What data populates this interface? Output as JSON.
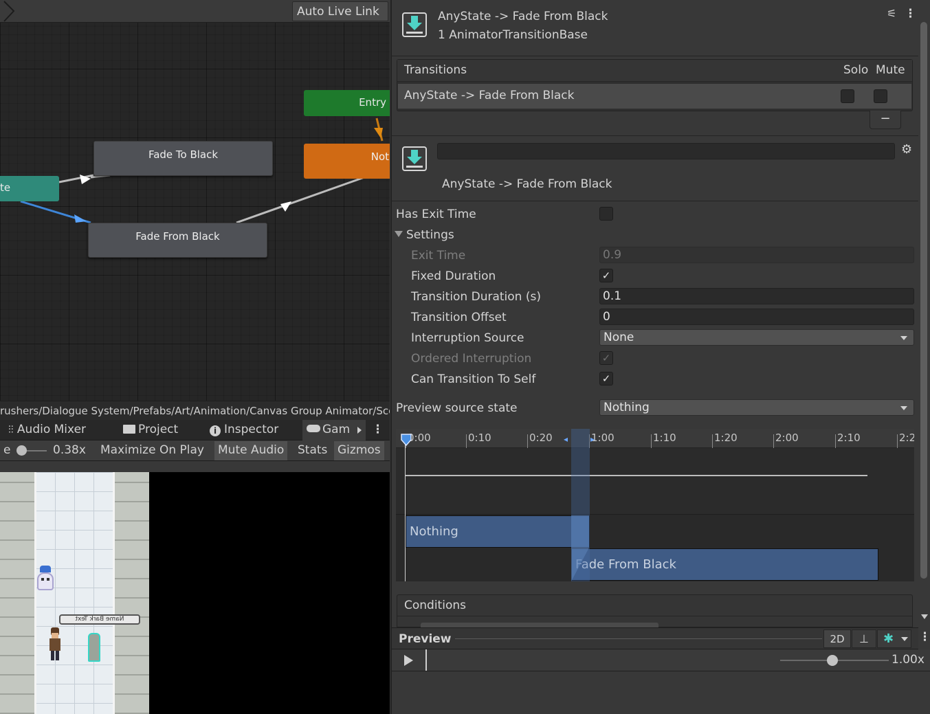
{
  "animator": {
    "auto_live_link": "Auto Live Link",
    "states": {
      "entry": "Entry",
      "not": "Not",
      "fade_to_black": "Fade To Black",
      "fade_from_black": "Fade From Black",
      "any_state_fragment": "te"
    },
    "path": "rushers/Dialogue System/Prefabs/Art/Animation/Canvas Group Animator/Scen"
  },
  "left_tabs": {
    "audio_mixer": "Audio Mixer",
    "project": "Project",
    "inspector": "Inspector",
    "game": "Gam"
  },
  "game_toolbar": {
    "scale_label_fragment": "e",
    "scale_value": "0.38x",
    "maximize_on_play": "Maximize On Play",
    "mute_audio": "Mute Audio",
    "stats": "Stats",
    "gizmos": "Gizmos",
    "bark_text": "Name Bark Text"
  },
  "inspector": {
    "header": {
      "title": "AnyState -> Fade From Black",
      "subtitle": "1 AnimatorTransitionBase"
    },
    "transitions": {
      "header": "Transitions",
      "solo": "Solo",
      "mute": "Mute",
      "row_label": "AnyState -> Fade From Black",
      "remove_button": "−"
    },
    "transition": {
      "name_value": "",
      "label": "AnyState -> Fade From Black"
    },
    "fields": {
      "has_exit_time": {
        "label": "Has Exit Time",
        "checked": false
      },
      "settings": "Settings",
      "exit_time": {
        "label": "Exit Time",
        "value": "0.9"
      },
      "fixed_duration": {
        "label": "Fixed Duration",
        "checked": true
      },
      "transition_duration": {
        "label": "Transition Duration (s)",
        "value": "0.1"
      },
      "transition_offset": {
        "label": "Transition Offset",
        "value": "0"
      },
      "interruption_source": {
        "label": "Interruption Source",
        "value": "None"
      },
      "ordered_interruption": {
        "label": "Ordered Interruption",
        "checked": true
      },
      "can_transition_to_self": {
        "label": "Can Transition To Self",
        "checked": true
      },
      "preview_source_state": {
        "label": "Preview source state",
        "value": "Nothing"
      }
    },
    "check_glyph": "✓",
    "timeline": {
      "ticks": [
        "0:00",
        "0:10",
        "0:20",
        "1:00",
        "1:10",
        "1:20",
        "2:00",
        "2:10",
        "2:2"
      ],
      "source_bar": "Nothing",
      "dest_bar": "Fade From Black"
    },
    "conditions": "Conditions",
    "preview": {
      "label": "Preview",
      "mode_2d": "2D",
      "speed": "1.00x"
    }
  },
  "colors": {
    "entry_green": "#1e7a2c",
    "state_orange": "#d06a14",
    "any_state_teal": "#2f8a7a",
    "timeline_bar_blue": "#3f5b85"
  }
}
